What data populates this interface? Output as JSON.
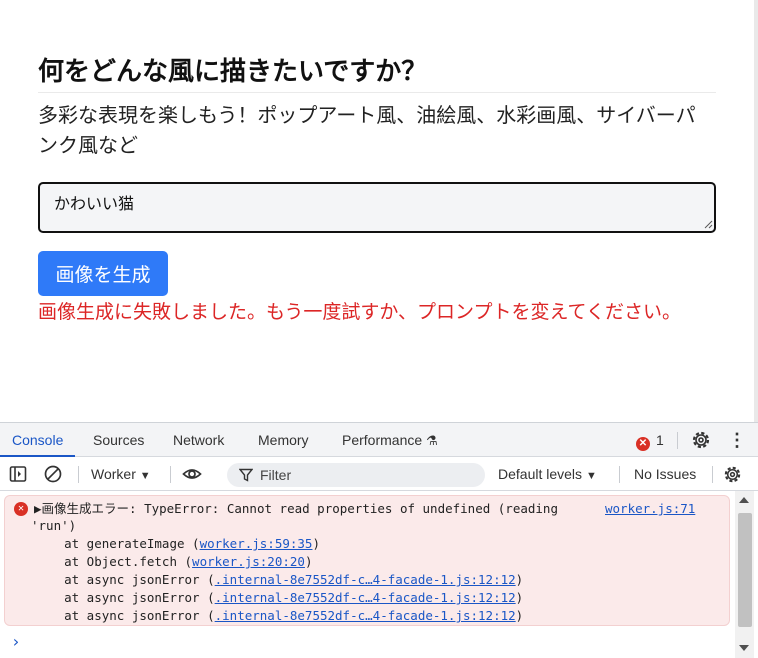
{
  "app": {
    "title": "何をどんな風に描きたいですか？",
    "subtitle": "多彩な表現を楽しもう！ポップアート風、油絵風、水彩画風、サイバーパンク風など",
    "prompt_value": "かわいい猫",
    "generate_button": "画像を生成",
    "error_message": "画像生成に失敗しました。もう一度試すか、プロンプトを変えてください。",
    "error_color": "#dc2626",
    "button_color": "#2f7af8"
  },
  "devtools": {
    "tabs": [
      "Console",
      "Sources",
      "Network",
      "Memory",
      "Performance"
    ],
    "active_tab": "Console",
    "error_count": "1",
    "toolbar": {
      "context": "Worker",
      "filter_placeholder": "Filter",
      "levels": "Default levels",
      "issues": "No Issues"
    },
    "log": {
      "message_line1": "▶画像生成エラー: TypeError: Cannot read properties of undefined (reading",
      "message_line2": "'run')",
      "source": "worker.js:71",
      "stack": [
        {
          "prefix": "    at generateImage (",
          "link": "worker.js:59:35",
          "suffix": ")"
        },
        {
          "prefix": "    at Object.fetch (",
          "link": "worker.js:20:20",
          "suffix": ")"
        },
        {
          "prefix": "    at async jsonError (",
          "link": ".internal-8e7552df-c…4-facade-1.js:12:12",
          "suffix": ")"
        },
        {
          "prefix": "    at async jsonError (",
          "link": ".internal-8e7552df-c…4-facade-1.js:12:12",
          "suffix": ")"
        },
        {
          "prefix": "    at async jsonError (",
          "link": ".internal-8e7552df-c…4-facade-1.js:12:12",
          "suffix": ")"
        }
      ]
    },
    "prompt_caret": "›"
  }
}
